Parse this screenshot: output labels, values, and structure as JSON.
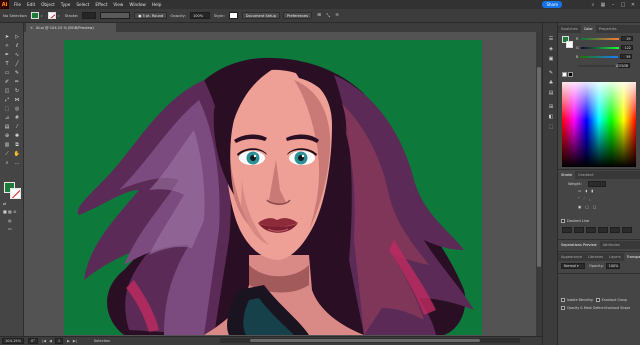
{
  "menubar": {
    "logo": "Ai",
    "items": [
      "File",
      "Edit",
      "Object",
      "Type",
      "Select",
      "Effect",
      "View",
      "Window",
      "Help"
    ],
    "share_label": "Share"
  },
  "controlbar": {
    "selection_label": "No Selection",
    "stroke_label": "Stroke:",
    "brush_label": "5 pt. Round",
    "opacity_label": "Opacity:",
    "opacity_value": "100%",
    "style_label": "Style:",
    "document_setup_label": "Document Setup",
    "preferences_label": "Preferences"
  },
  "document_tab": {
    "title": "AI.ai @ 104.15 % (RGB/Preview)"
  },
  "statusbar": {
    "zoom": "104.15%",
    "angle": "0°",
    "artboard_number": "1",
    "tool_status": "Selection"
  },
  "colors": {
    "fill": "#1d7a3b",
    "artboard_bg": "#0d7a3c",
    "accent": "#1473e6"
  },
  "color_panel": {
    "tabs": [
      "Swatches",
      "Color",
      "Properties"
    ],
    "active_tab": "Color",
    "sliders": [
      {
        "label": "R",
        "value": "29"
      },
      {
        "label": "G",
        "value": "122"
      },
      {
        "label": "B",
        "value": "59"
      },
      {
        "label": "",
        "value": "1D7A3B"
      }
    ]
  },
  "stroke_panel": {
    "tabs": [
      "Stroke",
      "Gradient"
    ],
    "weight_label": "Weight:",
    "dashed_line_label": "Dashed Line"
  },
  "separations_panel": {
    "tabs": [
      "Separations Preview",
      "Attributes"
    ]
  },
  "transparency_panel": {
    "tabs": [
      "Appearance",
      "Libraries",
      "Layers",
      "Transparency"
    ],
    "active_tab": "Transparency",
    "blend_mode": "Normal",
    "opacity_label": "Opacity:",
    "opacity_value": "100%",
    "isolate_blending": "Isolate Blending",
    "knockout_group": "Knockout Group",
    "opacity_mask_label": "Opacity & Mask Define Knockout Shape"
  }
}
